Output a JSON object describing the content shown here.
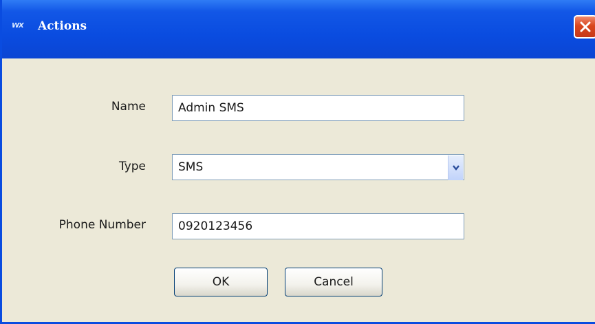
{
  "window": {
    "title": "Actions",
    "app_icon_text": "WX"
  },
  "form": {
    "name_label": "Name",
    "name_value": "Admin SMS",
    "type_label": "Type",
    "type_value": "SMS",
    "phone_label": "Phone Number",
    "phone_value": "0920123456"
  },
  "buttons": {
    "ok": "OK",
    "cancel": "Cancel"
  },
  "icons": {
    "app": "app-icon",
    "close": "close-icon",
    "dropdown": "chevron-down-icon"
  },
  "colors": {
    "titlebar": "#0a4ce0",
    "close": "#d8461e",
    "body": "#ece9d8"
  }
}
